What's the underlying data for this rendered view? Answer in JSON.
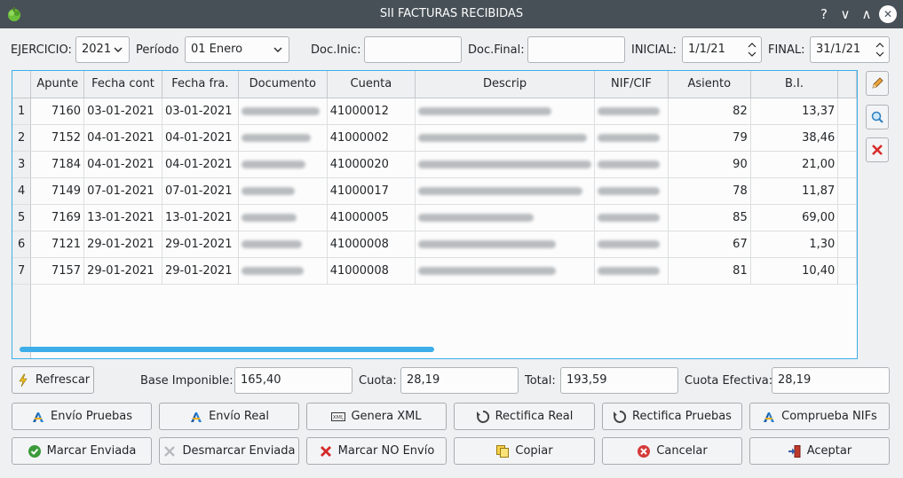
{
  "window": {
    "title": "SII FACTURAS RECIBIDAS",
    "help_label": "?",
    "minimize_label": "∨",
    "maximize_label": "∧",
    "close_label": "✕"
  },
  "filters": {
    "ejercicio_label": "EJERCICIO:",
    "ejercicio_value": "2021",
    "periodo_label": "Período",
    "periodo_value": "01 Enero",
    "doc_inic_label": "Doc.Inic:",
    "doc_inic_value": "",
    "doc_final_label": "Doc.Final:",
    "doc_final_value": "",
    "inicial_label": "INICIAL:",
    "inicial_value": "1/1/21",
    "final_label": "FINAL:",
    "final_value": "31/1/21"
  },
  "table": {
    "columns": [
      "Apunte",
      "Fecha cont",
      "Fecha fra.",
      "Documento",
      "Cuenta",
      "Descrip",
      "NIF/CIF",
      "Asiento",
      "B.I."
    ],
    "rows": [
      {
        "num": "1",
        "apunte": "7160",
        "fecha_cont": "03-01-2021",
        "fecha_fra": "03-01-2021",
        "cuenta": "41000012",
        "asiento": "82",
        "bi": "13,37"
      },
      {
        "num": "2",
        "apunte": "7152",
        "fecha_cont": "04-01-2021",
        "fecha_fra": "04-01-2021",
        "cuenta": "41000002",
        "asiento": "79",
        "bi": "38,46"
      },
      {
        "num": "3",
        "apunte": "7184",
        "fecha_cont": "04-01-2021",
        "fecha_fra": "04-01-2021",
        "cuenta": "41000020",
        "asiento": "90",
        "bi": "21,00"
      },
      {
        "num": "4",
        "apunte": "7149",
        "fecha_cont": "07-01-2021",
        "fecha_fra": "07-01-2021",
        "cuenta": "41000017",
        "asiento": "78",
        "bi": "11,87"
      },
      {
        "num": "5",
        "apunte": "7169",
        "fecha_cont": "13-01-2021",
        "fecha_fra": "13-01-2021",
        "cuenta": "41000005",
        "asiento": "85",
        "bi": "69,00"
      },
      {
        "num": "6",
        "apunte": "7121",
        "fecha_cont": "29-01-2021",
        "fecha_fra": "29-01-2021",
        "cuenta": "41000008",
        "asiento": "67",
        "bi": "1,30"
      },
      {
        "num": "7",
        "apunte": "7157",
        "fecha_cont": "29-01-2021",
        "fecha_fra": "29-01-2021",
        "cuenta": "41000008",
        "asiento": "81",
        "bi": "10,40"
      }
    ]
  },
  "totals": {
    "refrescar_label": "Refrescar",
    "base_label": "Base Imponible:",
    "base_value": "165,40",
    "cuota_label": "Cuota:",
    "cuota_value": "28,19",
    "total_label": "Total:",
    "total_value": "193,59",
    "cuota_efectiva_label": "Cuota Efectiva:",
    "cuota_efectiva_value": "28,19"
  },
  "actions_row1": {
    "envio_pruebas": "Envío Pruebas",
    "envio_real": "Envío Real",
    "genera_xml": "Genera XML",
    "rectifica_real": "Rectifica Real",
    "rectifica_pruebas": "Rectifica Pruebas",
    "comprueba_nifs": "Comprueba NIFs"
  },
  "actions_row2": {
    "marcar_enviada": "Marcar Enviada",
    "desmarcar_enviada": "Desmarcar Enviada",
    "marcar_no_envio": "Marcar NO Envío",
    "copiar": "Copiar",
    "cancelar": "Cancelar",
    "aceptar": "Aceptar"
  },
  "icons": {
    "xml_text": "XML"
  },
  "colors": {
    "accent": "#3daee9",
    "titlebar": "#475057"
  }
}
